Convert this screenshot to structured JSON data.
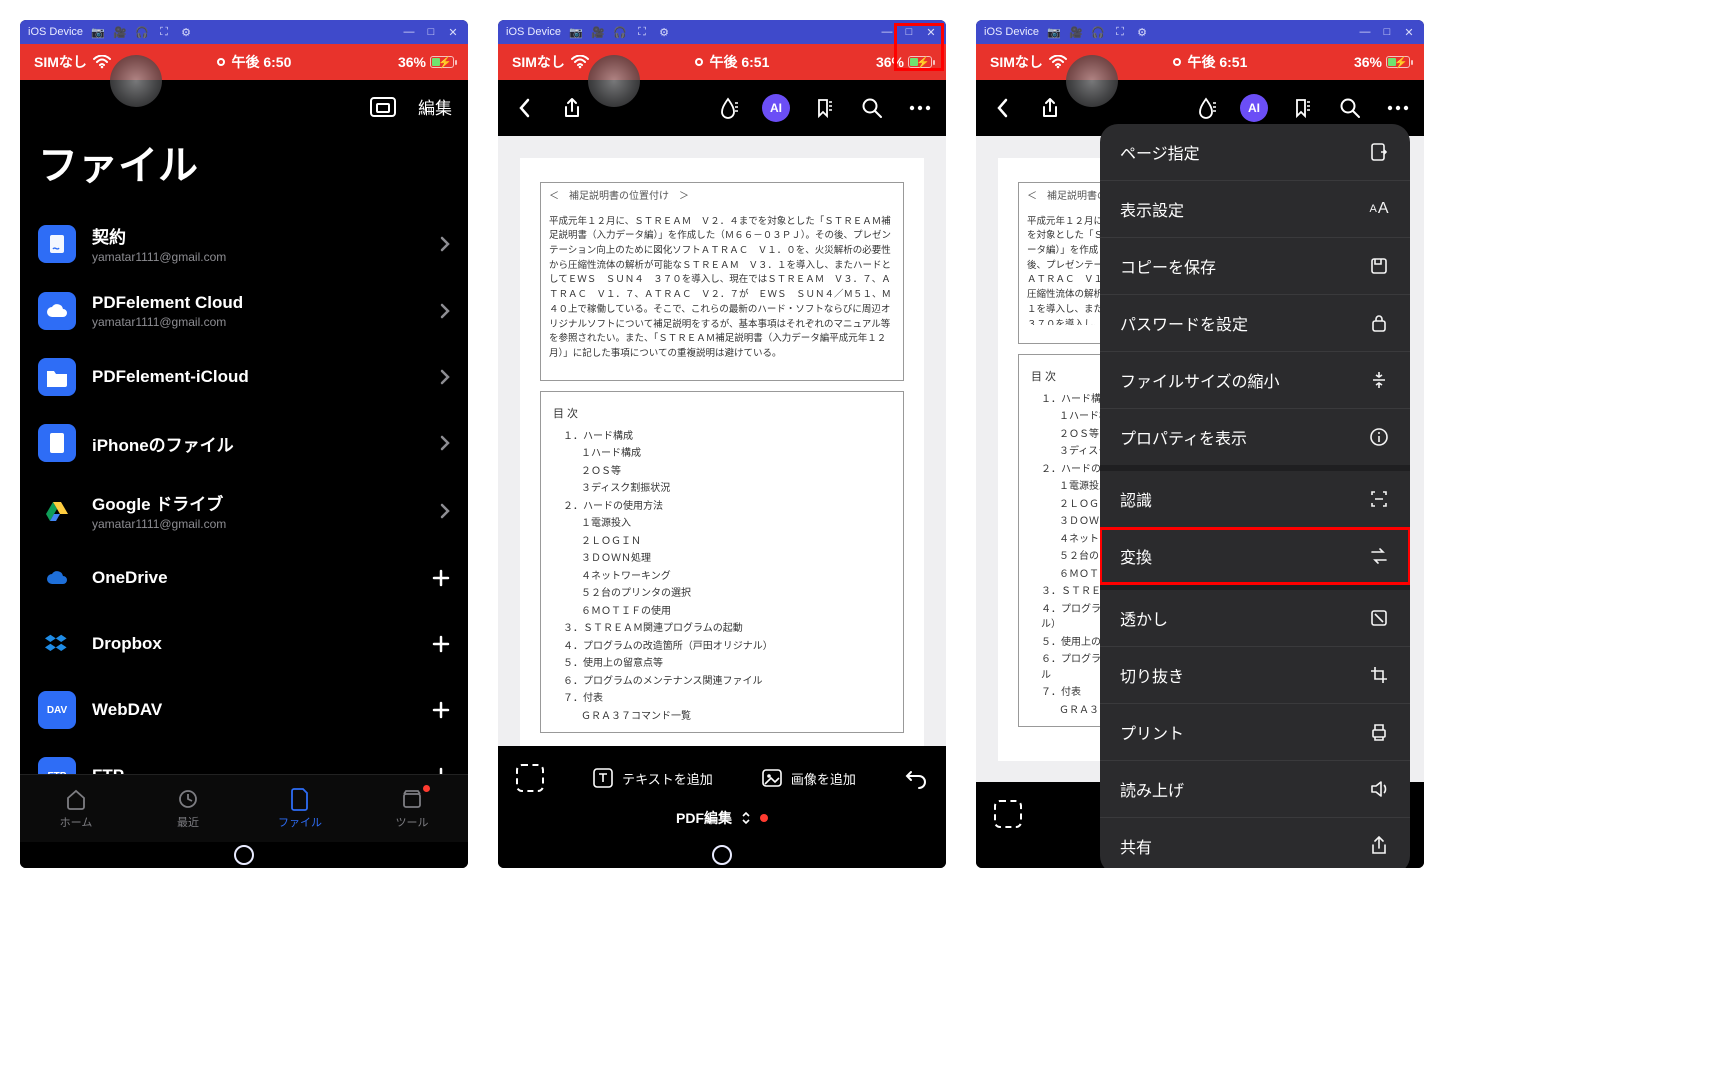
{
  "emu": {
    "device": "iOS Device"
  },
  "status": {
    "sim": "SIMなし",
    "time_a": "午後 6:50",
    "time_b": "午後 6:51",
    "battery": "36%"
  },
  "screen1": {
    "edit": "編集",
    "title": "ファイル",
    "rows": [
      {
        "title": "契約",
        "sub": "yamatar1111@gmail.com",
        "icon": "contract-icon",
        "act": "chevron"
      },
      {
        "title": "PDFelement Cloud",
        "sub": "yamatar1111@gmail.com",
        "icon": "cloud-icon",
        "act": "chevron"
      },
      {
        "title": "PDFelement-iCloud",
        "sub": "",
        "icon": "folder-icon",
        "act": "chevron"
      },
      {
        "title": "iPhoneのファイル",
        "sub": "",
        "icon": "iphone-files-icon",
        "act": "chevron"
      },
      {
        "title": "Google ドライブ",
        "sub": "yamatar1111@gmail.com",
        "icon": "gdrive-icon",
        "act": "chevron"
      },
      {
        "title": "OneDrive",
        "sub": "",
        "icon": "onedrive-icon",
        "act": "plus"
      },
      {
        "title": "Dropbox",
        "sub": "",
        "icon": "dropbox-icon",
        "act": "plus"
      },
      {
        "title": "WebDAV",
        "sub": "",
        "icon": "webdav-icon",
        "act": "plus"
      },
      {
        "title": "FTP",
        "sub": "",
        "icon": "ftp-icon",
        "act": "plus"
      }
    ],
    "tabs": [
      {
        "label": "ホーム",
        "name": "tab-home"
      },
      {
        "label": "最近",
        "name": "tab-recent"
      },
      {
        "label": "ファイル",
        "name": "tab-files"
      },
      {
        "label": "ツール",
        "name": "tab-tools"
      }
    ]
  },
  "doc": {
    "header": "＜　補足説明書の位置付け　＞",
    "para": "平成元年１２月に、ＳＴＲＥＡＭ　Ｖ２．４までを対象とした「ＳＴＲＥＡＭ補足説明書（入力データ編）」を作成した（Ｍ６６－０３ＰＪ）。その後、プレゼンテーション向上のために図化ソフトＡＴＲＡＣ　Ｖ１．０を、火災解析の必要性から圧縮性流体の解析が可能なＳＴＲＥＡＭ　Ｖ３．１を導入し、またハードとしてＥＷＳ　ＳＵＮ４　３７０を導入し、現在ではＳＴＲＥＡＭ　Ｖ３．７、ＡＴＲＡＣ　Ｖ１．７、ＡＴＲＡＣ　Ｖ２．７が　ＥＷＳ　ＳＵＮ４／Ｍ５１、Ｍ４０上で稼働している。そこで、これらの最新のハード・ソフトならびに周辺オリジナルソフトについて補足説明をするが、基本事項はそれぞれのマニュアル等を参照されたい。また、「ＳＴＲＥＡＭ補足説明書（入力データ編平成元年１２月）」に記した事項についての重複説明は避けている。",
    "toc_title": "目 次",
    "toc": [
      "１．ハード構成",
      "１ハード構成",
      "２ＯＳ等",
      "３ディスク割振状況",
      "２．ハードの使用方法",
      "１電源投入",
      "２ＬＯＧＩＮ",
      "３ＤＯＷＮ処理",
      "４ネットワーキング",
      "５２台のプリンタの選択",
      "６ＭＯＴＩＦの使用",
      "３．ＳＴＲＥＡＭ関連プログラムの起動",
      "４．プログラムの改造箇所（戸田オリジナル）",
      "５．使用上の留意点等",
      "６．プログラムのメンテナンス関連ファイル",
      "７．付表",
      "ＧＲＡ３７コマンド一覧"
    ]
  },
  "editbar": {
    "add_text": "テキストを追加",
    "add_image": "画像を追加",
    "mode": "PDF編集"
  },
  "menu": [
    {
      "label": "ページ指定",
      "icon": "goto-page-icon"
    },
    {
      "label": "表示設定",
      "icon": "text-size-icon"
    },
    {
      "label": "コピーを保存",
      "icon": "save-copy-icon"
    },
    {
      "label": "パスワードを設定",
      "icon": "lock-icon"
    },
    {
      "label": "ファイルサイズの縮小",
      "icon": "compress-icon"
    },
    {
      "label": "プロパティを表示",
      "icon": "info-icon"
    },
    {
      "label": "認識",
      "icon": "ocr-icon"
    },
    {
      "label": "変換",
      "icon": "convert-icon"
    },
    {
      "label": "透かし",
      "icon": "watermark-icon"
    },
    {
      "label": "切り抜き",
      "icon": "crop-icon"
    },
    {
      "label": "プリント",
      "icon": "print-icon"
    },
    {
      "label": "読み上げ",
      "icon": "speaker-icon"
    },
    {
      "label": "共有",
      "icon": "share-icon"
    }
  ]
}
